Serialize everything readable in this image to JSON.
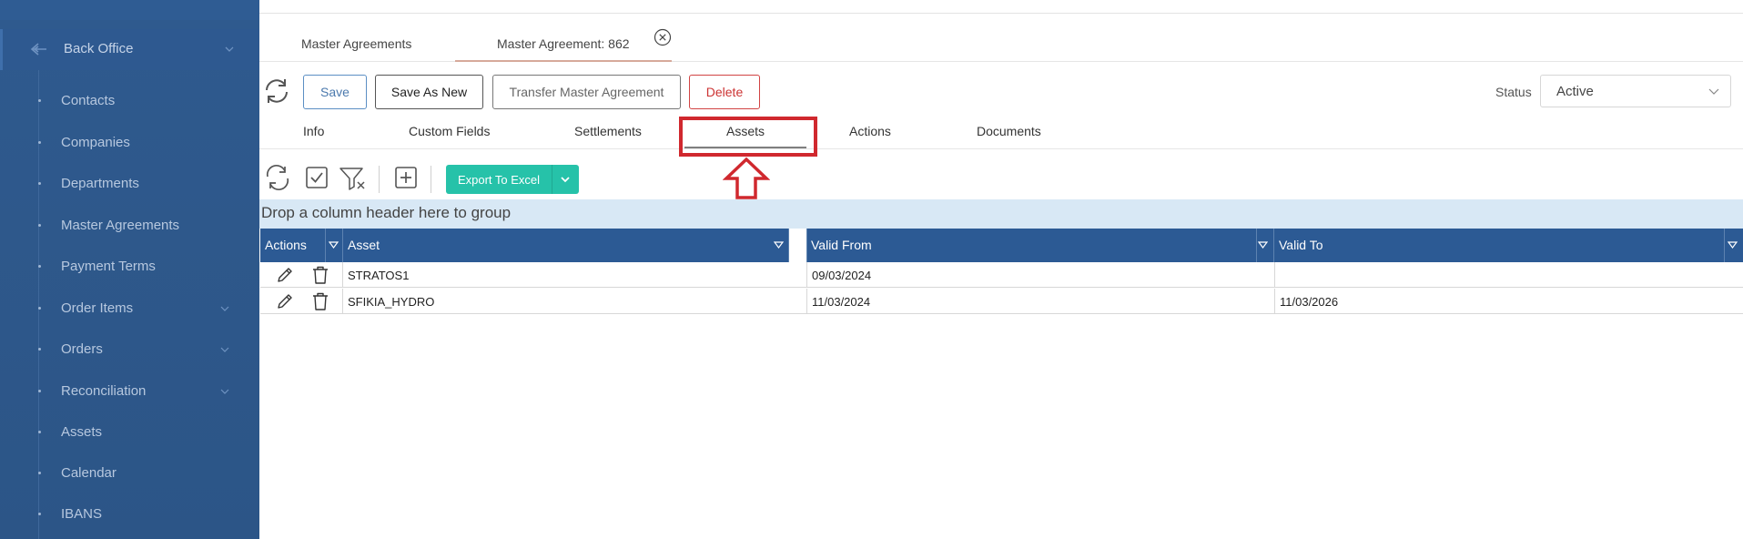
{
  "sidebar": {
    "section": {
      "label": "Back Office"
    },
    "items": [
      {
        "label": "Contacts",
        "has_children": false
      },
      {
        "label": "Companies",
        "has_children": false
      },
      {
        "label": "Departments",
        "has_children": false
      },
      {
        "label": "Master Agreements",
        "has_children": false
      },
      {
        "label": "Payment Terms",
        "has_children": false
      },
      {
        "label": "Order Items",
        "has_children": true
      },
      {
        "label": "Orders",
        "has_children": true
      },
      {
        "label": "Reconciliation",
        "has_children": true
      },
      {
        "label": "Assets",
        "has_children": false
      },
      {
        "label": "Calendar",
        "has_children": false
      },
      {
        "label": "IBANS",
        "has_children": false
      }
    ]
  },
  "page_tabs": [
    {
      "label": "Master Agreements",
      "active": false
    },
    {
      "label": "Master Agreement: 862",
      "active": true
    }
  ],
  "toolbar": {
    "save": "Save",
    "save_as_new": "Save As New",
    "transfer": "Transfer Master Agreement",
    "delete": "Delete"
  },
  "status": {
    "label": "Status",
    "value": "Active"
  },
  "sub_tabs": [
    {
      "label": "Info",
      "active": false
    },
    {
      "label": "Custom Fields",
      "active": false
    },
    {
      "label": "Settlements",
      "active": false
    },
    {
      "label": "Assets",
      "active": true
    },
    {
      "label": "Actions",
      "active": false
    },
    {
      "label": "Documents",
      "active": false
    }
  ],
  "grid": {
    "export_label": "Export To Excel",
    "group_hint": "Drop a column header here to group",
    "columns": [
      "Actions",
      "Asset",
      "Valid From",
      "Valid To"
    ],
    "rows": [
      {
        "asset": "STRATOS1",
        "valid_from": "09/03/2024",
        "valid_to": ""
      },
      {
        "asset": "SFIKIA_HYDRO",
        "valid_from": "11/03/2024",
        "valid_to": "11/03/2026"
      }
    ]
  },
  "colors": {
    "sidebar": "#2e5990",
    "header": "#2c5a94",
    "accent": "#26c2a9",
    "highlight": "#d0282e",
    "danger": "#cc3333"
  }
}
